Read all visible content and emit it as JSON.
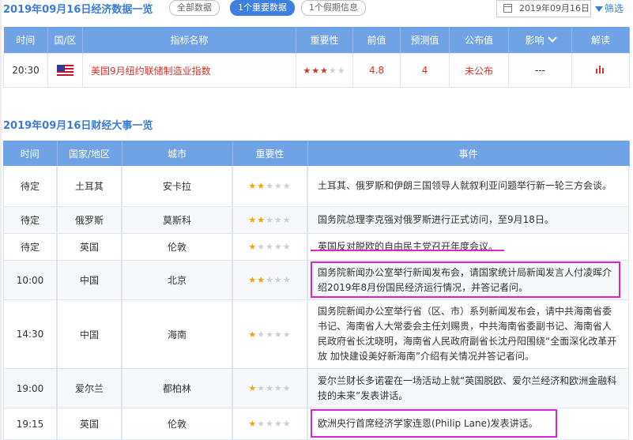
{
  "header": {
    "title": "2019年09月16日经济数据一览",
    "pills": [
      "全部数据",
      "1个重要数据",
      "1个假期信息"
    ],
    "date": "2019年09月16日",
    "filter_label": "筛选"
  },
  "econ_table": {
    "columns": [
      "时间",
      "国/区",
      "指标名称",
      "重要性",
      "前值",
      "预测值",
      "公布值",
      "影响",
      "解读"
    ],
    "rows": [
      {
        "time": "20:30",
        "country_icon": "us-flag-icon",
        "indicator": "美国9月纽约联储制造业指数",
        "importance": 3,
        "previous": "4.8",
        "forecast": "4",
        "actual": "未公布",
        "impact": "---",
        "analysis_icon": "bar-chart-icon"
      }
    ]
  },
  "events_title": "2019年09月16日财经大事一览",
  "events_table": {
    "columns": [
      "时间",
      "国家/地区",
      "城市",
      "重要性",
      "事件"
    ],
    "rows": [
      {
        "time": "待定",
        "country": "土耳其",
        "city": "安卡拉",
        "importance": 2,
        "event": "土耳其、俄罗斯和伊朗三国领导人就叙利亚问题举行新一轮三方会谈。"
      },
      {
        "time": "待定",
        "country": "俄罗斯",
        "city": "莫斯科",
        "importance": 2,
        "event": "国务院总理李克强对俄罗斯进行正式访问，至9月18日。"
      },
      {
        "time": "待定",
        "country": "英国",
        "city": "伦敦",
        "importance": 1,
        "event": "英国反对脱欧的自由民主党召开年度会议。"
      },
      {
        "time": "10:00",
        "country": "中国",
        "city": "北京",
        "importance": 2,
        "event": "国务院新闻办公室举行新闻发布会，请国家统计局新闻发言人付凌晖介绍2019年8月份国民经济运行情况，并答记者问。"
      },
      {
        "time": "14:30",
        "country": "中国",
        "city": "海南",
        "importance": 1,
        "event": "国务院新闻办公室举行省（区、市）系列新闻发布会，请中共海南省委书记、海南省人大常委会主任刘赐贵，中共海南省委副书记、海南省人民政府省长沈晓明，海南省人民政府副省长沈丹阳围绕“全面深化改革开放 加快建设美好新海南”介绍有关情况并答记者问。"
      },
      {
        "time": "19:00",
        "country": "爱尔兰",
        "city": "都柏林",
        "importance": 1,
        "event": "爱尔兰财长多诺霍在一场活动上就“英国脱欧、爱尔兰经济和欧洲金融科技的未来”发表讲话。"
      },
      {
        "time": "19:15",
        "country": "英国",
        "city": "伦敦",
        "importance": 1,
        "event": "欧洲央行首席经济学家连恩(Philip Lane)发表讲话。"
      }
    ]
  },
  "colors": {
    "header_blue": "#6fa3e6",
    "title_blue": "#3a7bd5",
    "highlight_magenta": "#e025c8",
    "red": "#d0342c",
    "star_gold": "#f0a500"
  }
}
